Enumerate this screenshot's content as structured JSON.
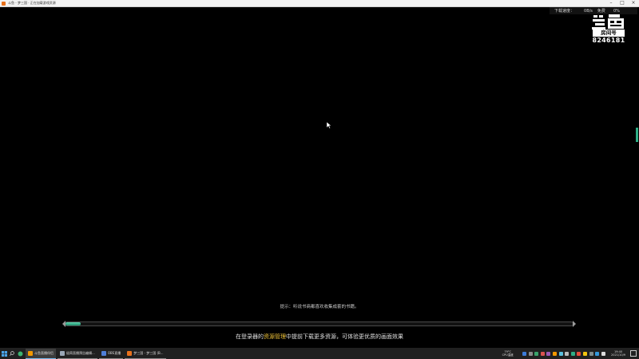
{
  "window": {
    "title": "斗鱼 - 梦三国 · 正在加载游戏资源",
    "min_glyph": "–",
    "max_glyph": "□",
    "close_glyph": "×"
  },
  "download": {
    "label": "下载速度：",
    "speed": "0B/s",
    "label2": "免费",
    "percent": "0%"
  },
  "watermark": {
    "brand": "斗鱼",
    "room_label": "房间号",
    "room_number": "8246181"
  },
  "loading": {
    "hint": "提示：听说书商都喜欢收集成套的书籍。",
    "progress": 0.03,
    "tip_before": "在登录器的",
    "tip_highlight": "资源管理",
    "tip_after": "中提前下载更多资源，可体验更优质的画面效果"
  },
  "taskbar": {
    "tasks": [
      {
        "label": "斗鱼直播伴侣",
        "color": "#f39800",
        "state": "active"
      },
      {
        "label": "极简直播预告编辑...",
        "color": "#9aa7b6",
        "state": "open"
      },
      {
        "label": "OBS直播",
        "color": "#4f7fd8",
        "state": "open"
      },
      {
        "label": "梦三国 - 梦三国 (B...",
        "color": "#e8711c",
        "state": "open"
      }
    ],
    "cpu_line1": "79°C",
    "cpu_line2": "CPU温度",
    "time": "19:40",
    "date": "2021/10/9"
  },
  "colors": {
    "progress_fill": "#2fae86",
    "tip_highlight": "#f0c43a",
    "taskbar_bg": "#202020"
  }
}
